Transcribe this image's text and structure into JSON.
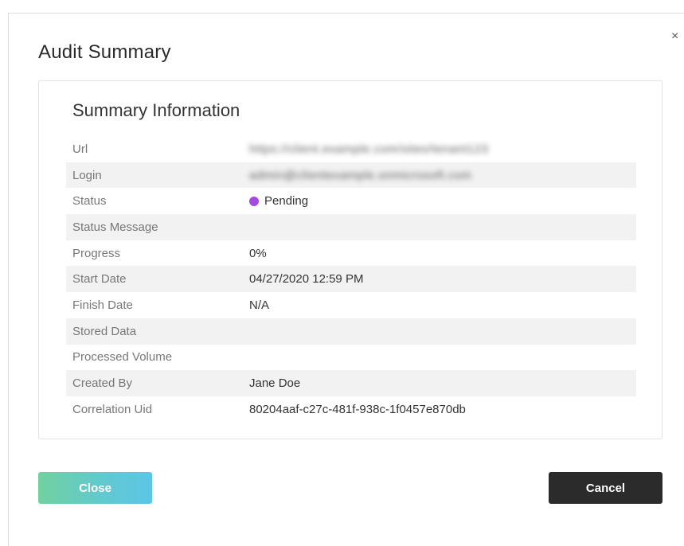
{
  "dialog": {
    "title": "Audit Summary",
    "close_glyph": "×"
  },
  "card": {
    "title": "Summary Information",
    "rows": [
      {
        "label": "Url",
        "value": "https://client.example.com/sites/tenant123",
        "blurred": true
      },
      {
        "label": "Login",
        "value": "admin@clientexample.onmicrosoft.com",
        "blurred": true
      },
      {
        "label": "Status",
        "value": "Pending",
        "status_color": "#a14bdf"
      },
      {
        "label": "Status Message",
        "value": ""
      },
      {
        "label": "Progress",
        "value": "0%"
      },
      {
        "label": "Start Date",
        "value": "04/27/2020 12:59 PM"
      },
      {
        "label": "Finish Date",
        "value": "N/A"
      },
      {
        "label": "Stored Data",
        "value": ""
      },
      {
        "label": "Processed Volume",
        "value": ""
      },
      {
        "label": "Created By",
        "value": "Jane Doe"
      },
      {
        "label": "Correlation Uid",
        "value": "80204aaf-c27c-481f-938c-1f0457e870db"
      }
    ]
  },
  "buttons": {
    "close_label": "Close",
    "cancel_label": "Cancel"
  },
  "colors": {
    "status_pending": "#a14bdf",
    "cancel_bg": "#2b2b2b",
    "close_gradient_start": "#71d1a0",
    "close_gradient_end": "#5cc6e8"
  }
}
